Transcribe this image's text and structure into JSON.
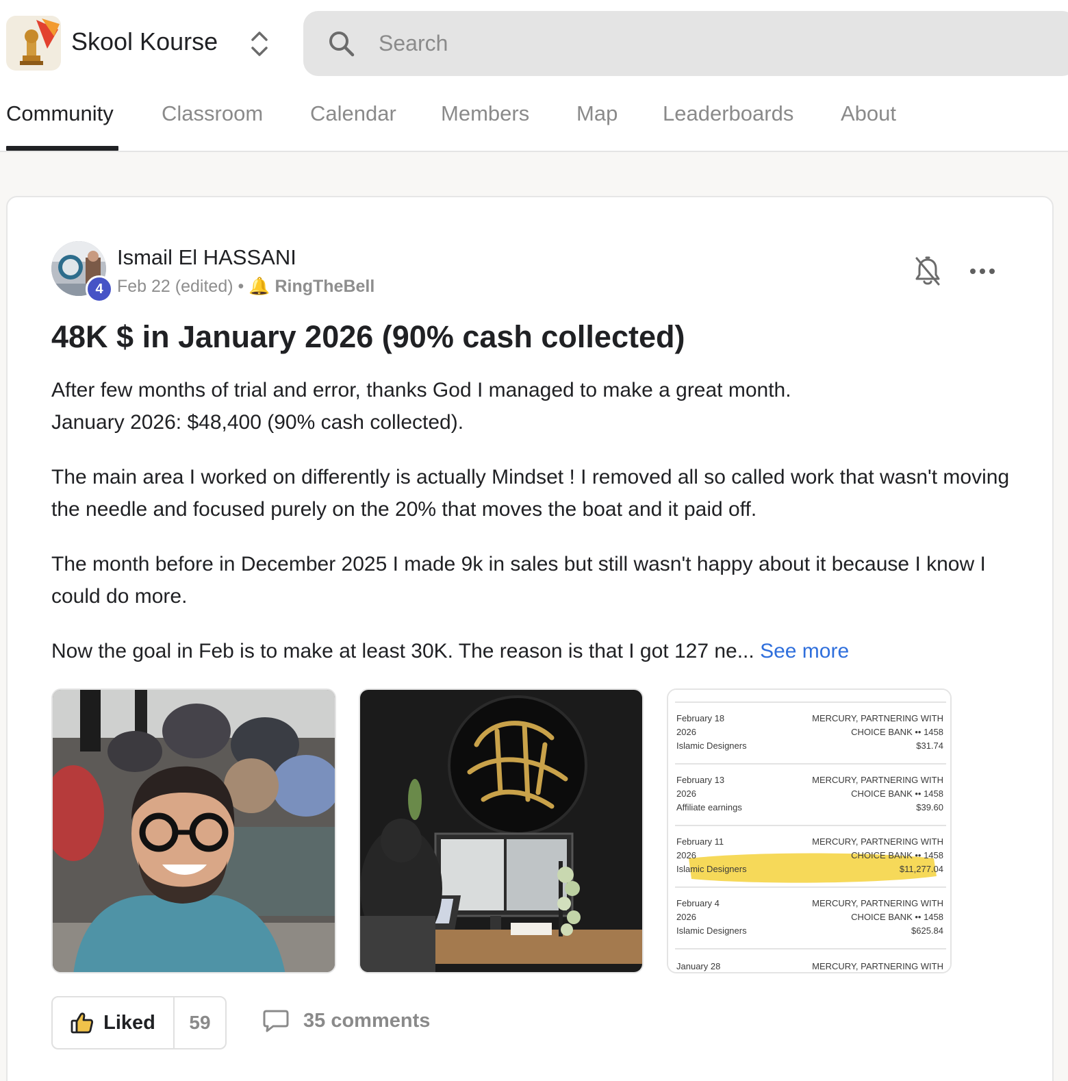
{
  "brand": {
    "name": "Skool Kourse"
  },
  "search": {
    "placeholder": "Search"
  },
  "tabs": [
    {
      "label": "Community"
    },
    {
      "label": "Classroom"
    },
    {
      "label": "Calendar"
    },
    {
      "label": "Members"
    },
    {
      "label": "Map"
    },
    {
      "label": "Leaderboards"
    },
    {
      "label": "About"
    }
  ],
  "active_tab": "Community",
  "post": {
    "author": "Ismail El HASSANI",
    "level": "4",
    "date": "Feb 22 (edited)",
    "separator": "•",
    "category_emoji": "🔔",
    "category": "RingTheBell",
    "title": "48K $ in January 2026 (90% cash collected)",
    "paragraphs": [
      "After few months of trial and error, thanks God I managed to make a great month.\nJanuary 2026: $48,400 (90% cash collected).",
      "The main area I worked on differently is actually Mindset ! I removed all so called work that wasn't moving the needle and focused purely on the 20% that moves the boat and it paid off.",
      "The month before in December 2025 I made 9k in sales but still wasn't happy about it because I know I could do more."
    ],
    "truncated_text": "Now the goal in Feb is to make at least 30K. The reason is that I got 127 ne...",
    "see_more": "See more",
    "like_label": "Liked",
    "like_count": "59",
    "comments_label": "35 comments"
  },
  "statement": {
    "rows": [
      {
        "date": "February 18",
        "year": "2026",
        "source": "Islamic Designers",
        "bank1": "MERCURY, PARTNERING WITH",
        "bank2": "CHOICE BANK •• 1458",
        "amount": "$31.74"
      },
      {
        "date": "February 13",
        "year": "2026",
        "source": "Affiliate earnings",
        "bank1": "MERCURY, PARTNERING WITH",
        "bank2": "CHOICE BANK •• 1458",
        "amount": "$39.60"
      },
      {
        "date": "February 11",
        "year": "2026",
        "source": "Islamic Designers",
        "bank1": "MERCURY, PARTNERING WITH",
        "bank2": "CHOICE BANK •• 1458",
        "amount": "$11,277.04"
      },
      {
        "date": "February 4",
        "year": "2026",
        "source": "Islamic Designers",
        "bank1": "MERCURY, PARTNERING WITH",
        "bank2": "CHOICE BANK •• 1458",
        "amount": "$625.84"
      },
      {
        "date": "January 28",
        "bank1": "MERCURY, PARTNERING WITH"
      }
    ],
    "highlight_color": "#f5d23c"
  },
  "colors": {
    "accent_link": "#2f6fdc",
    "level_badge": "#4653c6",
    "tab_active": "#202124",
    "tab_inactive": "#8a8a8a"
  },
  "icons": [
    "trophy-logo",
    "chevron-up-down-icon",
    "search-icon",
    "bell-off-icon",
    "more-horizontal-icon",
    "thumbs-up-icon",
    "comment-icon"
  ]
}
